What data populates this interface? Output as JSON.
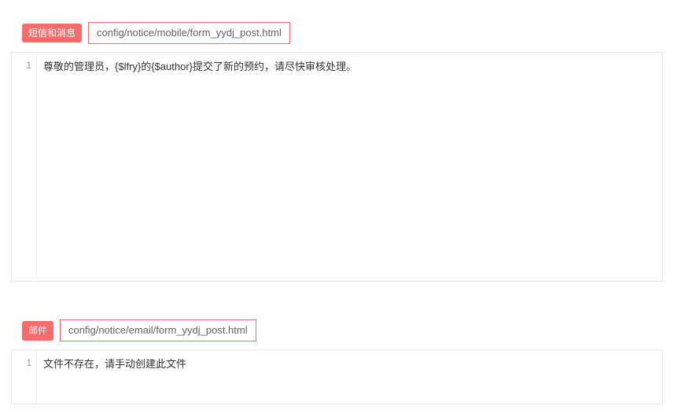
{
  "section1": {
    "tag": "短信和消息",
    "path": "config/notice/mobile/form_yydj_post.html",
    "gutter": "1",
    "content": "尊敬的管理员，{$lfry}的{$author}提交了新的预约，请尽快审核处理。"
  },
  "section2": {
    "tag": "邮件",
    "path": "config/notice/email/form_yydj_post.html",
    "gutter": "1",
    "content": "文件不存在，请手动创建此文件"
  }
}
